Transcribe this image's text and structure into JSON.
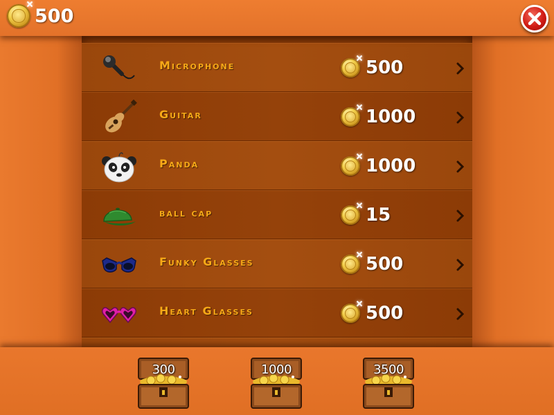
{
  "header": {
    "balance": "500",
    "coin_icon": "gold-coin-icon",
    "close_icon": "close-x-icon"
  },
  "items": [
    {
      "name": "Microphone",
      "price": "500",
      "icon": "microphone-icon"
    },
    {
      "name": "Guitar",
      "price": "1000",
      "icon": "guitar-icon"
    },
    {
      "name": "Panda",
      "price": "1000",
      "icon": "panda-icon"
    },
    {
      "name": "ball cap",
      "price": "15",
      "icon": "ball-cap-icon"
    },
    {
      "name": "Funky Glasses",
      "price": "500",
      "icon": "funky-glasses-icon"
    },
    {
      "name": "Heart Glasses",
      "price": "500",
      "icon": "heart-glasses-icon"
    }
  ],
  "coin_packs": [
    {
      "amount": "300",
      "icon": "treasure-chest-icon"
    },
    {
      "amount": "1000",
      "icon": "treasure-chest-icon"
    },
    {
      "amount": "3500",
      "icon": "treasure-chest-icon"
    }
  ],
  "colors": {
    "background": "#e8782c",
    "item_name": "#f7a917",
    "close_button": "#d11b14"
  }
}
